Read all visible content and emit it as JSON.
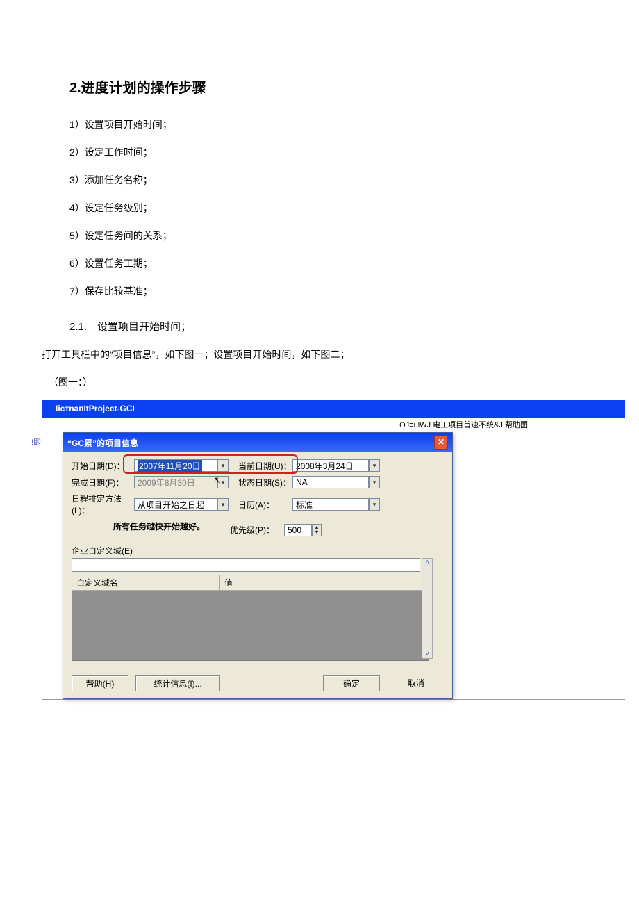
{
  "heading": "2.进度计划的操作步骤",
  "steps": [
    "1）设置项目开始时间；",
    "2）设定工作时间；",
    "3）添加任务名称；",
    "4）设定任务级别；",
    "5）设定任务间的关系；",
    "6）设置任务工期；",
    "7）保存比较基准；"
  ],
  "subheading": "2.1.　设置项目开始时间；",
  "para": "打开工具栏中的“项目信息”，如下图一；设置项目开始时间，如下图二；",
  "figure_label": "（图一：）",
  "app_title": "IiстnапItProject-GCI",
  "app_subtext": "OJ≡ulWJ 电工项目首速不统&J 帮助图",
  "left_note": "!即文件",
  "dialog": {
    "title": "“GC累”的项目信息",
    "labels": {
      "start_date": "开始日期(D)：",
      "finish_date": "完成日期(F)：",
      "schedule_from": "日程排定方法(L)：",
      "current_date": "当前日期(U)：",
      "status_date": "状态日期(S)：",
      "calendar": "日历(A)：",
      "priority": "优先级(P)：",
      "enterprise": "企业自定义域(E)",
      "custom_name": "自定义域名",
      "value": "值"
    },
    "values": {
      "start_date": "2007年11月20日",
      "finish_date": "2009年8月30日",
      "schedule_from": "从项目开始之日起",
      "current_date": "2008年3月24日",
      "status_date": "NA",
      "calendar": "标准",
      "priority": "500"
    },
    "hint": "所有任务越快开始越好。",
    "buttons": {
      "help": "帮助(H)",
      "stats": "统计信息(I)...",
      "ok": "确定",
      "cancel": "取消"
    }
  }
}
